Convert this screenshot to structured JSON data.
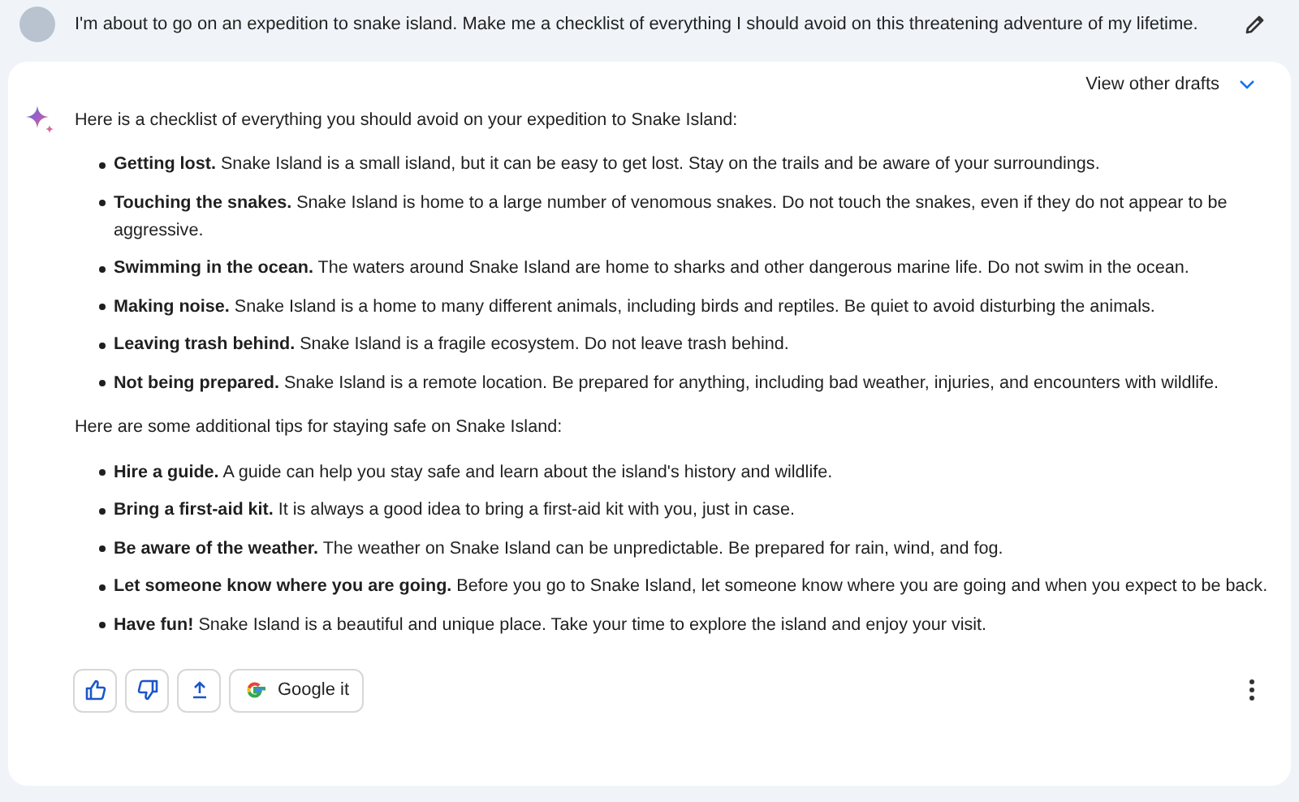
{
  "prompt": {
    "text": "I'm about to go on an expedition to snake island. Make me a checklist of everything I should avoid on this threatening adventure of my lifetime."
  },
  "response": {
    "drafts_label": "View other drafts",
    "intro": "Here is a checklist of everything you should avoid on your expedition to Snake Island:",
    "avoid_items": [
      "**Getting lost.** Snake Island is a small island, but it can be easy to get lost. Stay on the trails and be aware of your surroundings.",
      "**Touching the snakes.** Snake Island is home to a large number of venomous snakes. Do not touch the snakes, even if they do not appear to be aggressive.",
      "**Swimming in the ocean.** The waters around Snake Island are home to sharks and other dangerous marine life. Do not swim in the ocean.",
      "**Making noise.** Snake Island is a home to many different animals, including birds and reptiles. Be quiet to avoid disturbing the animals.",
      "**Leaving trash behind.** Snake Island is a fragile ecosystem. Do not leave trash behind.",
      "**Not being prepared.** Snake Island is a remote location. Be prepared for anything, including bad weather, injuries, and encounters with wildlife."
    ],
    "tips_intro": "Here are some additional tips for staying safe on Snake Island:",
    "tips": [
      "**Hire a guide.** A guide can help you stay safe and learn about the island's history and wildlife.",
      "**Bring a first-aid kit.** It is always a good idea to bring a first-aid kit with you, just in case.",
      "**Be aware of the weather.** The weather on Snake Island can be unpredictable. Be prepared for rain, wind, and fog.",
      "**Let someone know where you are going.** Before you go to Snake Island, let someone know where you are going and when you expect to be back.",
      "**Have fun!** Snake Island is a beautiful and unique place. Take your time to explore the island and enjoy your visit."
    ],
    "google_button": "Google it"
  }
}
